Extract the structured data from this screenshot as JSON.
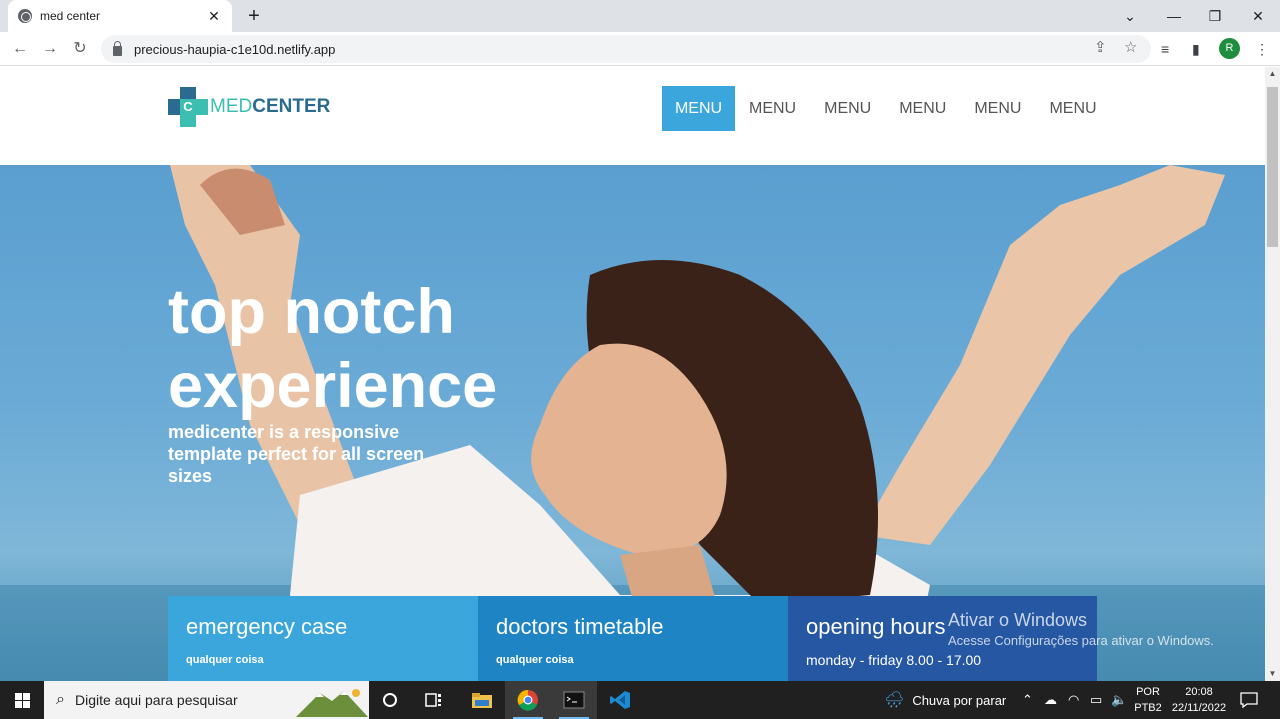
{
  "browser": {
    "tab_title": "med center",
    "tab_close": "✕",
    "new_tab": "+",
    "url": "precious-haupia-c1e10d.netlify.app",
    "profile_initial": "R",
    "window_controls": {
      "collapse": "⌄",
      "minimize": "—",
      "restore": "❐",
      "close": "✕"
    }
  },
  "site": {
    "logo": {
      "mark_letter": "C",
      "text_light": "MED",
      "text_bold": "CENTER"
    },
    "menu": [
      "MENU",
      "MENU",
      "MENU",
      "MENU",
      "MENU",
      "MENU"
    ],
    "hero": {
      "title": "top notch experience",
      "subtitle": "medicenter is a responsive template perfect for all screen sizes"
    },
    "boxes": [
      {
        "title": "emergency case",
        "text": "qualquer coisa"
      },
      {
        "title": "doctors timetable",
        "text": "qualquer coisa"
      },
      {
        "title": "opening hours",
        "text": "monday - friday 8.00 - 17.00"
      }
    ]
  },
  "watermark": {
    "line1": "Ativar o Windows",
    "line2": "Acesse Configurações para ativar o Windows."
  },
  "taskbar": {
    "search_placeholder": "Digite aqui para pesquisar",
    "weather": "Chuva por parar",
    "lang_line1": "POR",
    "lang_line2": "PTB2",
    "time": "20:08",
    "date": "22/11/2022"
  },
  "colors": {
    "menu_active": "#3aa6dc",
    "box1": "#3aa6dc",
    "box2": "#1f84c4",
    "box3": "#2557a3",
    "logo_teal": "#3cbfb1",
    "logo_dark": "#2a6b8f"
  }
}
